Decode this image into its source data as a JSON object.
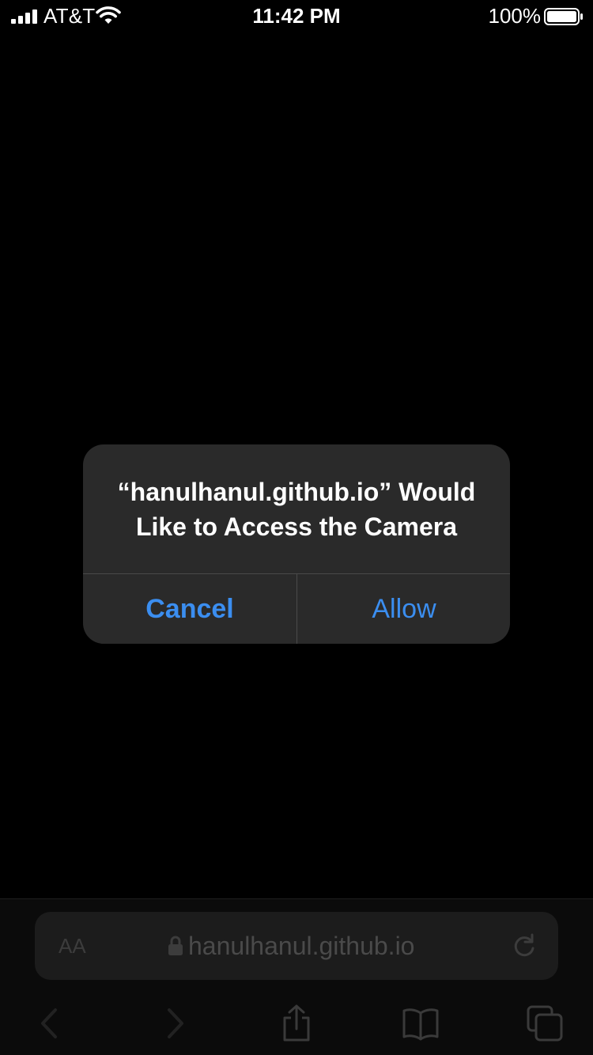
{
  "status_bar": {
    "carrier": "AT&T",
    "time": "11:42 PM",
    "battery_percent": "100%"
  },
  "alert": {
    "title": "“hanulhanul.github.io” Would Like to Access the Camera",
    "cancel_label": "Cancel",
    "allow_label": "Allow"
  },
  "toolbar": {
    "text_size_label": "AA",
    "url": "hanulhanul.github.io"
  },
  "colors": {
    "background": "#000000",
    "alert_background": "#2a2a2a",
    "accent_blue": "#3b8ef0",
    "toolbar_dimmed": "#3c3c3c"
  },
  "icons": [
    "cellular-signal-icon",
    "wifi-icon",
    "battery-icon",
    "lock-icon",
    "reload-icon",
    "back-icon",
    "forward-icon",
    "share-icon",
    "bookmarks-icon",
    "tabs-icon"
  ]
}
